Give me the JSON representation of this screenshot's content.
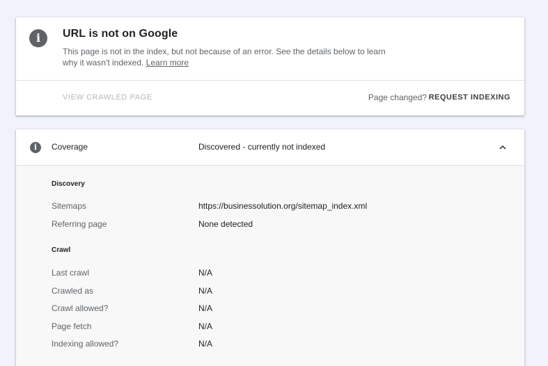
{
  "status_card": {
    "info_icon": "info-icon",
    "title": "URL is not on Google",
    "description": "This page is not in the index, but not because of an error. See the details below to learn why it wasn't indexed.",
    "learn_more": "Learn more",
    "view_crawled_page": "VIEW CRAWLED PAGE",
    "page_changed": "Page changed?",
    "request_indexing": "REQUEST INDEXING"
  },
  "coverage": {
    "info_icon": "info-icon",
    "label": "Coverage",
    "value": "Discovered - currently not indexed",
    "chevron_icon": "chevron-up-icon",
    "discovery": {
      "title": "Discovery",
      "rows": [
        {
          "label": "Sitemaps",
          "value": "https://businessolution.org/sitemap_index.xml"
        },
        {
          "label": "Referring page",
          "value": "None detected"
        }
      ]
    },
    "crawl": {
      "title": "Crawl",
      "rows": [
        {
          "label": "Last crawl",
          "value": "N/A"
        },
        {
          "label": "Crawled as",
          "value": "N/A"
        },
        {
          "label": "Crawl allowed?",
          "value": "N/A"
        },
        {
          "label": "Page fetch",
          "value": "N/A"
        },
        {
          "label": "Indexing allowed?",
          "value": "N/A"
        }
      ]
    }
  },
  "colors": {
    "background": "#f1f3fb",
    "card": "#ffffff",
    "icon_gray": "#5f6368",
    "disabled_text": "#b4b7bb"
  }
}
